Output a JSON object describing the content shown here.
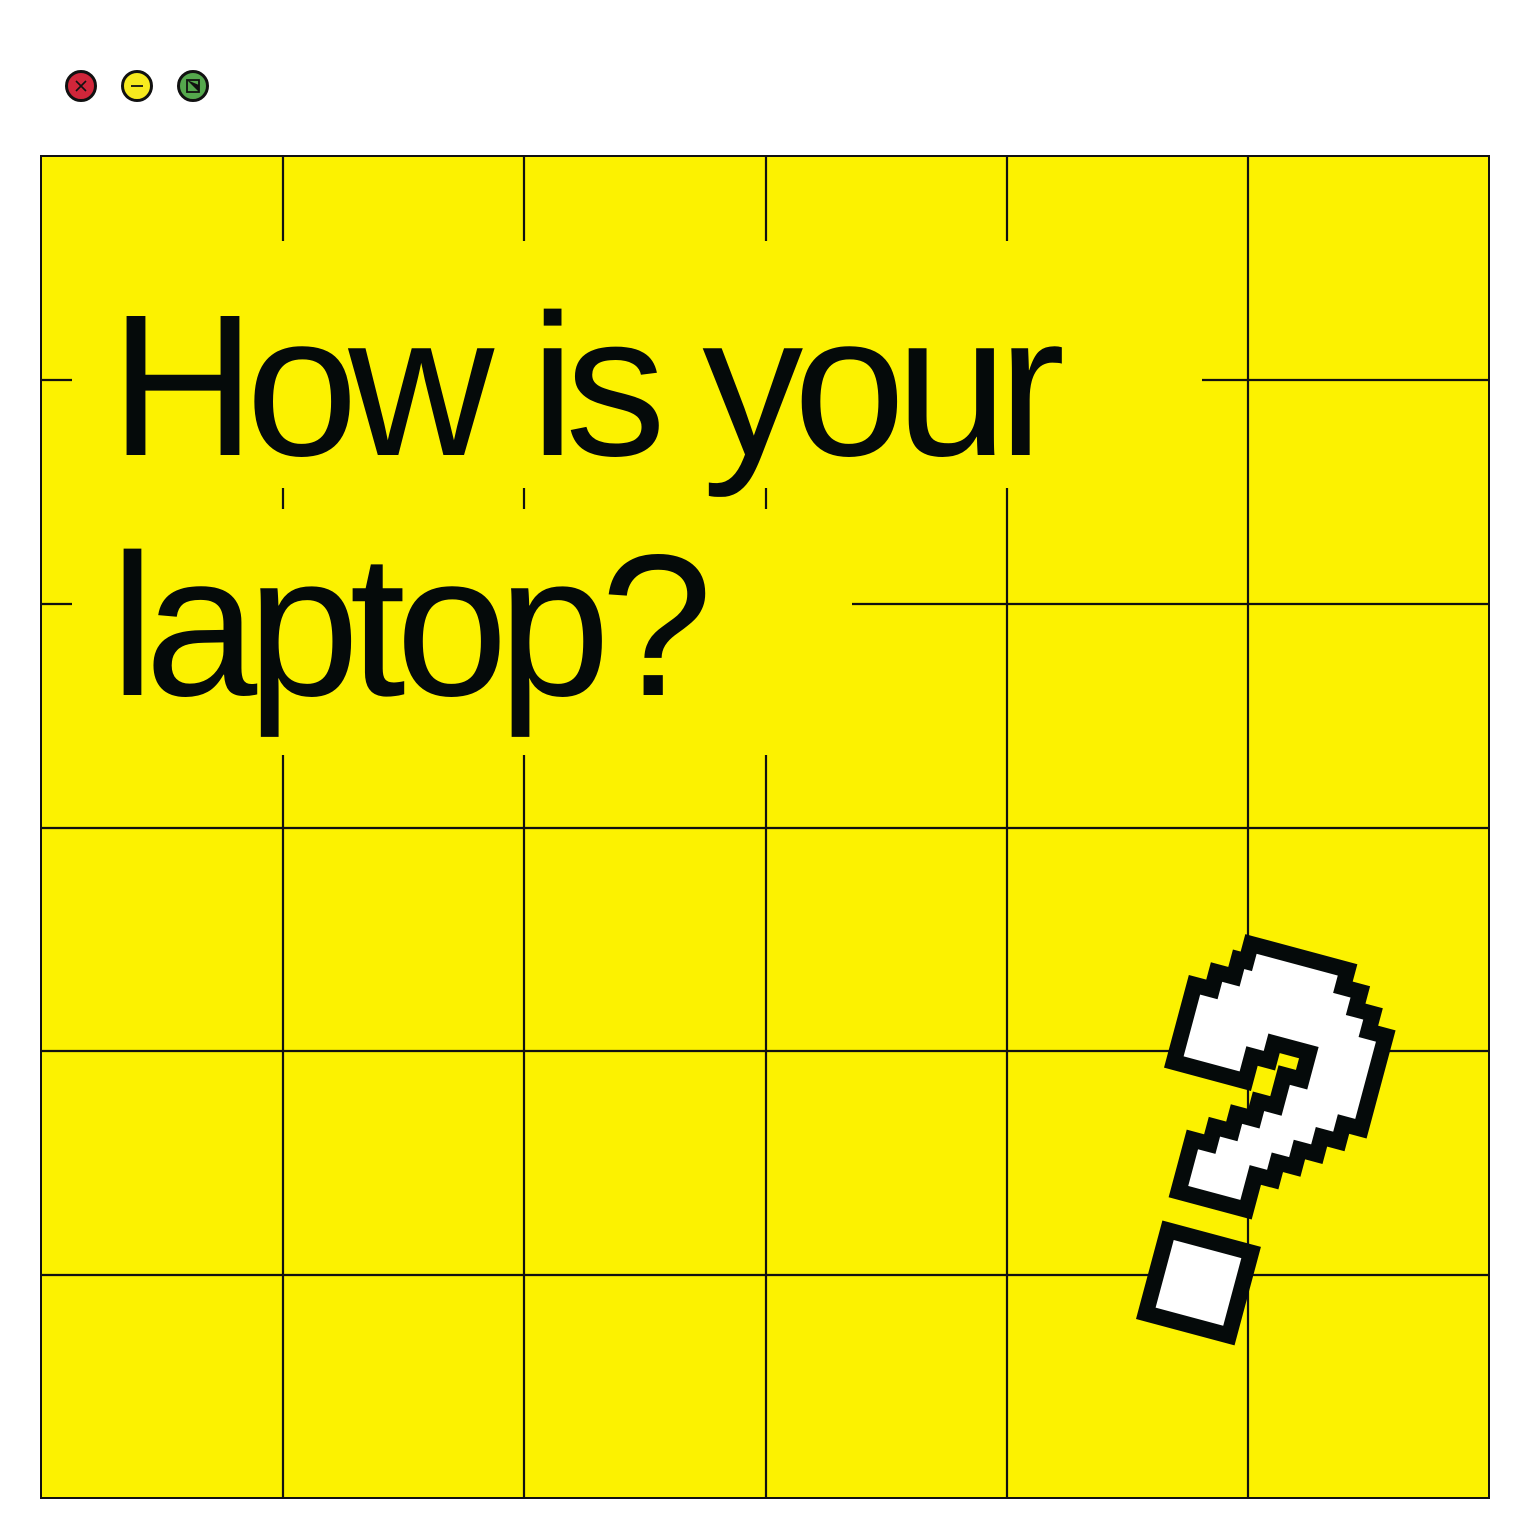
{
  "window": {
    "controls": [
      {
        "name": "close",
        "icon": "close-x-icon",
        "color": "#d1263a"
      },
      {
        "name": "minimize",
        "icon": "minus-icon",
        "color": "#f7ea1e"
      },
      {
        "name": "maximize",
        "icon": "expand-arrow-icon",
        "color": "#55a84d"
      }
    ]
  },
  "main": {
    "headline": {
      "line1": "How is your",
      "line2": "laptop?"
    },
    "background_color": "#fcf200",
    "grid_color": "#111111",
    "text_color": "#050a0a",
    "illustration": "pixel-question-mark-icon"
  }
}
